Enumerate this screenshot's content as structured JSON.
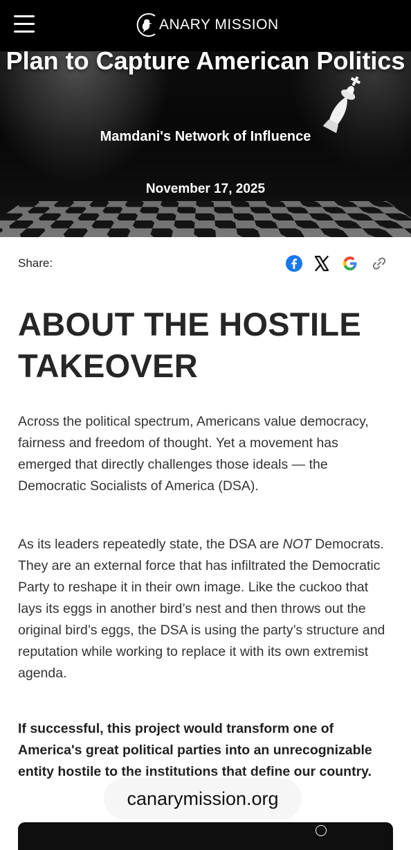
{
  "nav": {
    "menu_icon": "hamburger-menu-icon",
    "logo_text": "ANARY MISSION",
    "logo_icon": "canary-bird-icon"
  },
  "hero": {
    "title": "Plan to Capture American Politics",
    "subtitle": "Mamdani's Network of Influence",
    "date": "November 17, 2025"
  },
  "share": {
    "label": "Share:",
    "icons": [
      "facebook-icon",
      "x-icon",
      "google-icon",
      "link-icon"
    ]
  },
  "article": {
    "heading": "ABOUT THE HOSTILE TAKEOVER",
    "paragraph1": "Across the political spectrum, Americans value democracy, fairness and freedom of thought. Yet a movement has emerged that directly challenges those ideals — the Democratic Socialists of America (DSA).",
    "paragraph2_before": "As its leaders repeatedly state, the DSA are ",
    "paragraph2_em": "NOT",
    "paragraph2_after": " Democrats. They are an external force that has infiltrated the Democratic Party to reshape it in their own image. Like the cuckoo that lays its eggs in another bird’s nest and then throws out the original bird’s eggs, the DSA is using the party’s structure and reputation while working to replace it with its own extremist agenda.",
    "paragraph3": "If successful, this project would transform one of America's great political parties into an unrecognizable entity hostile to the institutions that define our country."
  },
  "watermark": "canarymission.org",
  "colors": {
    "facebook": "#1877F2",
    "text": "#333333",
    "nav_bg": "#000000"
  }
}
